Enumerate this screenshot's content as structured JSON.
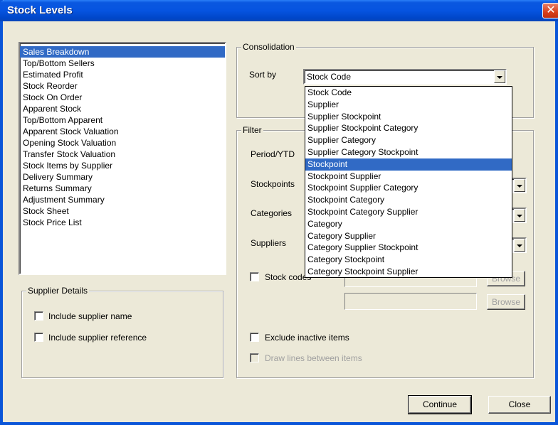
{
  "window": {
    "title": "Stock Levels",
    "close_glyph": "✕"
  },
  "reports": {
    "selected_index": 0,
    "items": [
      "Sales Breakdown",
      "Top/Bottom Sellers",
      "Estimated Profit",
      "Stock Reorder",
      "Stock On Order",
      "Apparent Stock",
      "Top/Bottom Apparent",
      "Apparent Stock Valuation",
      "Opening Stock Valuation",
      "Transfer Stock Valuation",
      "Stock Items by Supplier",
      "Delivery Summary",
      "Returns Summary",
      "Adjustment Summary",
      "Stock Sheet",
      "Stock Price List"
    ]
  },
  "supplier_details": {
    "label": "Supplier Details",
    "include_name": "Include supplier name",
    "include_reference": "Include supplier reference"
  },
  "consolidation": {
    "label": "Consolidation",
    "sort_by_label": "Sort by",
    "sort_by_value": "Stock Code",
    "options": [
      "Stock Code",
      "Supplier",
      "Supplier Stockpoint",
      "Supplier Stockpoint Category",
      "Supplier Category",
      "Supplier Category Stockpoint",
      "Stockpoint",
      "Stockpoint Supplier",
      "Stockpoint Supplier Category",
      "Stockpoint Category",
      "Stockpoint Category Supplier",
      "Category",
      "Category Supplier",
      "Category Supplier Stockpoint",
      "Category Stockpoint",
      "Category Stockpoint Supplier"
    ],
    "highlighted_option": "Stockpoint"
  },
  "filter": {
    "label": "Filter",
    "period_label": "Period/YTD",
    "stockpoints_label": "Stockpoints",
    "categories_label": "Categories",
    "suppliers_label": "Suppliers",
    "stock_codes_label": "Stock codes",
    "browse_1": "Browse",
    "browse_2": "Browse",
    "exclude_inactive": "Exclude inactive items",
    "draw_lines": "Draw lines between items"
  },
  "buttons": {
    "continue": "Continue",
    "close": "Close"
  }
}
